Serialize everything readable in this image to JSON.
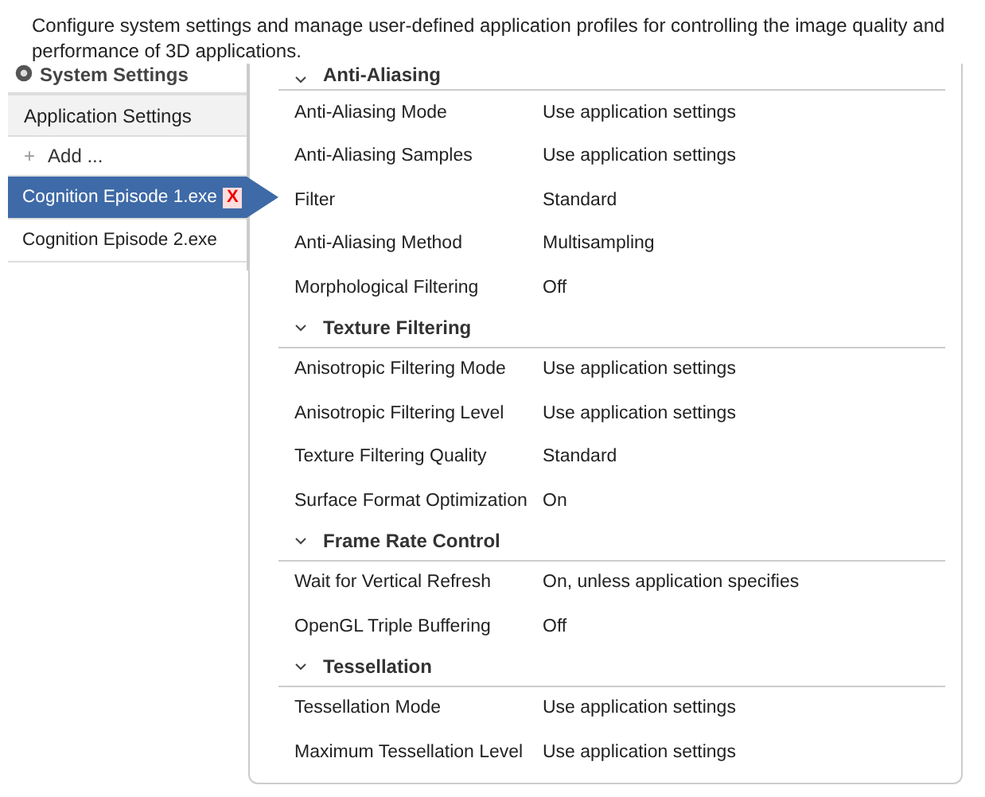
{
  "description": "Configure system settings and manage user-defined application profiles for controlling the image quality and performance of 3D applications.",
  "sidebar": {
    "items": [
      {
        "kind": "system",
        "label": "System Settings",
        "selected": false
      },
      {
        "kind": "group",
        "label": "Application Settings",
        "selected": false
      },
      {
        "kind": "add",
        "icon": "+",
        "label": "Add ...",
        "selected": false
      },
      {
        "kind": "app",
        "label": "Cognition Episode 1.exe",
        "selected": true,
        "delete_icon": "X"
      },
      {
        "kind": "app",
        "label": "Cognition Episode 2.exe",
        "selected": false
      }
    ]
  },
  "sections": [
    {
      "title": "Anti-Aliasing",
      "expanded": true,
      "rows": [
        {
          "label": "Anti-Aliasing Mode",
          "value": "Use application settings"
        },
        {
          "label": "Anti-Aliasing Samples",
          "value": "Use application settings"
        },
        {
          "label": "Filter",
          "value": "Standard"
        },
        {
          "label": "Anti-Aliasing Method",
          "value": "Multisampling"
        },
        {
          "label": "Morphological Filtering",
          "value": "Off"
        }
      ]
    },
    {
      "title": "Texture Filtering",
      "expanded": true,
      "rows": [
        {
          "label": "Anisotropic Filtering Mode",
          "value": "Use application settings"
        },
        {
          "label": "Anisotropic Filtering Level",
          "value": "Use application settings"
        },
        {
          "label": "Texture Filtering Quality",
          "value": "Standard"
        },
        {
          "label": "Surface Format Optimization",
          "value": "On"
        }
      ]
    },
    {
      "title": "Frame Rate Control",
      "expanded": true,
      "rows": [
        {
          "label": "Wait for Vertical Refresh",
          "value": "On, unless application specifies"
        },
        {
          "label": "OpenGL Triple Buffering",
          "value": "Off"
        }
      ]
    },
    {
      "title": "Tessellation",
      "expanded": true,
      "rows": [
        {
          "label": "Tessellation Mode",
          "value": "Use application settings"
        },
        {
          "label": "Maximum Tessellation Level",
          "value": "Use application settings"
        }
      ]
    }
  ]
}
